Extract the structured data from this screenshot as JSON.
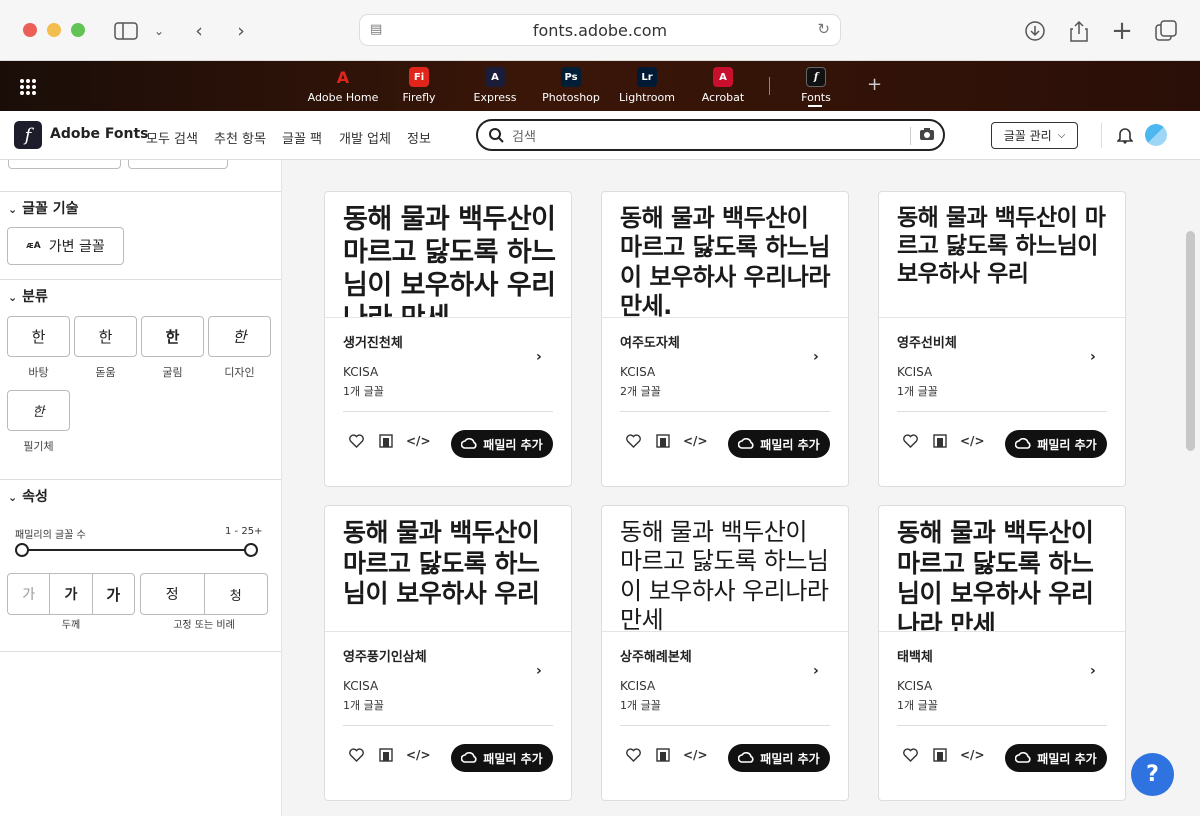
{
  "browser": {
    "url": "fonts.adobe.com"
  },
  "app_bar": {
    "apps": [
      {
        "label": "Adobe Home",
        "color": "#e1251b",
        "glyph": "A"
      },
      {
        "label": "Firefly",
        "color": "#e1251b",
        "glyph": "Fi"
      },
      {
        "label": "Express",
        "color": "#1b1b3a",
        "glyph": "A"
      },
      {
        "label": "Photoshop",
        "color": "#001e36",
        "glyph": "Ps"
      },
      {
        "label": "Lightroom",
        "color": "#001a36",
        "glyph": "Lr"
      },
      {
        "label": "Acrobat",
        "color": "#c8102e",
        "glyph": "A"
      },
      {
        "label": "Fonts",
        "color": "#111111",
        "glyph": "f"
      }
    ],
    "plus": "+"
  },
  "header": {
    "logo_text": "Adobe Fonts",
    "logo_glyph": "f",
    "nav": [
      "모두 검색",
      "추천 항목",
      "글꼴 팩",
      "개발 업체",
      "정보"
    ],
    "search_placeholder": "검색",
    "manage_label": "글꼴 관리"
  },
  "sidebar": {
    "tech": {
      "title": "글꼴 기술",
      "variable_label": "가변 글꼴"
    },
    "classification": {
      "title": "분류",
      "items": [
        {
          "glyph": "한",
          "label": "바탕"
        },
        {
          "glyph": "한",
          "label": "돋움"
        },
        {
          "glyph": "한",
          "label": "굴림"
        },
        {
          "glyph": "한",
          "label": "디자인"
        },
        {
          "glyph": "한",
          "label": "필기체"
        }
      ]
    },
    "properties": {
      "title": "속성",
      "family_count_label": "패밀리의 글꼴 수",
      "family_count_range": "1 - 25+",
      "weight_glyphs": [
        "가",
        "가",
        "가"
      ],
      "weight_label": "두께",
      "width_glyphs": [
        "정",
        "청"
      ],
      "width_label": "고정 또는 비례"
    }
  },
  "cards": [
    {
      "sample": "동해 물과 백두산이 마르고 닳도록 하느님이 보우하사 우리나라 만세.",
      "name": "생거진천체",
      "foundry": "KCISA",
      "count": "1개 글꼴",
      "add_label": "패밀리 추가",
      "weight": "900",
      "size": "27"
    },
    {
      "sample": "동해 물과 백두산이 마르고 닳도록 하느님이 보우하사 우리나라 만세.",
      "name": "여주도자체",
      "foundry": "KCISA",
      "count": "2개 글꼴",
      "add_label": "패밀리 추가",
      "weight": "700",
      "size": "24"
    },
    {
      "sample": "동해 물과 백두산이 마르고 닳도록 하느님이 보우하사 우리",
      "name": "영주선비체",
      "foundry": "KCISA",
      "count": "1개 글꼴",
      "add_label": "패밀리 추가",
      "weight": "700",
      "size": "23"
    },
    {
      "sample": "동해 물과 백두산이 마르고 닳도록 하느님이 보우하사 우리",
      "name": "영주풍기인삼체",
      "foundry": "KCISA",
      "count": "1개 글꼴",
      "add_label": "패밀리 추가",
      "weight": "900",
      "size": "25"
    },
    {
      "sample": "동해 물과 백두산이 마르고 닳도록 하느님이 보우하사 우리나라 만세",
      "name": "상주해례본체",
      "foundry": "KCISA",
      "count": "1개 글꼴",
      "add_label": "패밀리 추가",
      "weight": "400",
      "size": "24"
    },
    {
      "sample": "동해 물과 백두산이 마르고 닳도록 하느님이 보우하사 우리나라 만세",
      "name": "태백체",
      "foundry": "KCISA",
      "count": "1개 글꼴",
      "add_label": "패밀리 추가",
      "weight": "900",
      "size": "25"
    }
  ],
  "help_label": "?"
}
